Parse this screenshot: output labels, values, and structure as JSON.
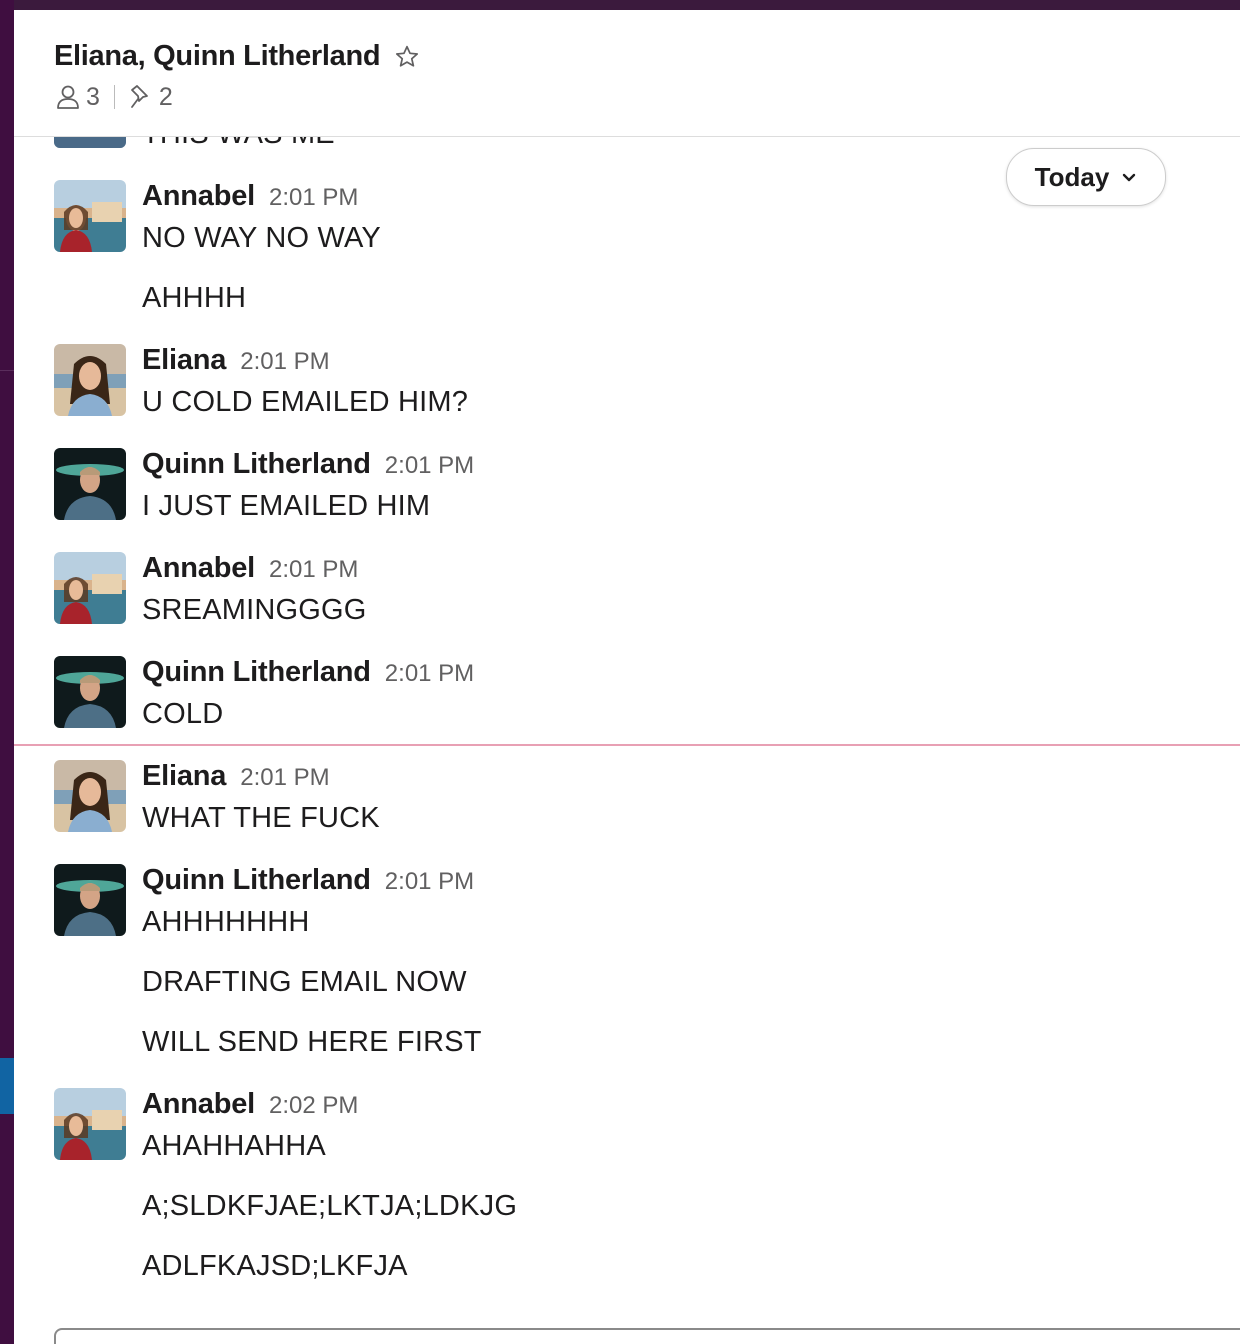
{
  "channel": {
    "title": "Eliana, Quinn Litherland",
    "member_count": "3",
    "pinned_count": "2"
  },
  "jump_to": {
    "label": "Today"
  },
  "partial_message": "THIS WAS ME",
  "messages": [
    {
      "sender": "Annabel",
      "time": "2:01 PM",
      "lines": [
        "NO WAY NO WAY",
        "AHHHH"
      ]
    },
    {
      "sender": "Eliana",
      "time": "2:01 PM",
      "lines": [
        "U COLD EMAILED HIM?"
      ]
    },
    {
      "sender": "Quinn Litherland",
      "time": "2:01 PM",
      "lines": [
        "I JUST EMAILED HIM"
      ]
    },
    {
      "sender": "Annabel",
      "time": "2:01 PM",
      "lines": [
        "SREAMINGGGG"
      ]
    },
    {
      "sender": "Quinn Litherland",
      "time": "2:01 PM",
      "lines": [
        "COLD"
      ]
    },
    {
      "sender": "Eliana",
      "time": "2:01 PM",
      "lines": [
        "WHAT THE FUCK"
      ]
    },
    {
      "sender": "Quinn Litherland",
      "time": "2:01 PM",
      "lines": [
        "AHHHHHHH",
        "DRAFTING EMAIL NOW",
        "WILL SEND HERE FIRST"
      ]
    },
    {
      "sender": "Annabel",
      "time": "2:02 PM",
      "lines": [
        "AHAHHAHHA",
        "A;SLDKFJAE;LKTJA;LDKJG",
        "ADLFKAJSD;LKFJA"
      ]
    }
  ]
}
